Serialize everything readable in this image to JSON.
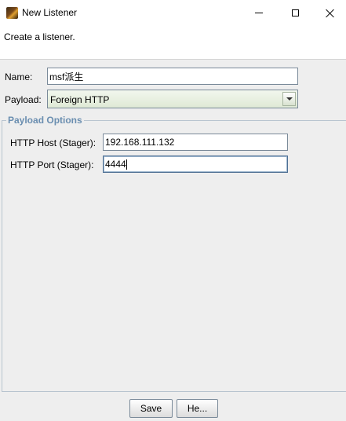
{
  "window": {
    "title": "New Listener"
  },
  "description": "Create a listener.",
  "form": {
    "name_label": "Name:",
    "name_value": "msf派生",
    "payload_label": "Payload:",
    "payload_value": "Foreign HTTP"
  },
  "payload_options": {
    "title": "Payload Options",
    "host_label": "HTTP Host (Stager):",
    "host_value": "192.168.111.132",
    "port_label": "HTTP Port (Stager):",
    "port_value": "4444"
  },
  "buttons": {
    "save": "Save",
    "help": "He..."
  },
  "icons": {
    "app": "app-icon",
    "minimize": "minimize-icon",
    "maximize": "maximize-icon",
    "close": "close-icon",
    "dropdown": "chevron-down-icon"
  },
  "colors": {
    "group_title": "#6a8eb0",
    "combo_bg": "#e6eedf"
  }
}
